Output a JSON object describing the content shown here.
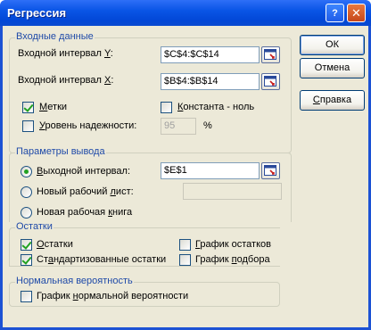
{
  "window": {
    "title": "Регрессия",
    "help_glyph": "?",
    "close_glyph": "✕"
  },
  "input_group": {
    "title": "Входные данные",
    "y_label_pre": "Входной интервал ",
    "y_label_acc": "Y",
    "y_label_post": ":",
    "y_value": "$C$4:$C$14",
    "x_label_pre": "Входной интервал ",
    "x_label_acc": "X",
    "x_label_post": ":",
    "x_value": "$B$4:$B$14",
    "labels_pre": "",
    "labels_acc": "М",
    "labels_post": "етки",
    "labels_checked": true,
    "const_pre": "",
    "const_acc": "К",
    "const_post": "онстанта - ноль",
    "const_checked": false,
    "conf_pre": "",
    "conf_acc": "У",
    "conf_post": "ровень надежности:",
    "conf_checked": false,
    "conf_value": "95",
    "conf_unit": "%"
  },
  "output_group": {
    "title": "Параметры вывода",
    "opt_range_pre": "",
    "opt_range_acc": "В",
    "opt_range_post": "ыходной интервал:",
    "opt_range_value": "$E$1",
    "opt_sheet_pre": "Новый рабочий ",
    "opt_sheet_acc": "л",
    "opt_sheet_post": "ист:",
    "opt_sheet_value": "",
    "opt_book_pre": "Новая рабочая ",
    "opt_book_acc": "к",
    "opt_book_post": "нига",
    "selected": "range"
  },
  "residuals_group": {
    "title": "Остатки",
    "resid_pre": "",
    "resid_acc": "О",
    "resid_post": "статки",
    "resid_checked": true,
    "std_pre": "Ст",
    "std_acc": "а",
    "std_post": "ндартизованные остатки",
    "std_checked": true,
    "resid_plot_pre": "",
    "resid_plot_acc": "Г",
    "resid_plot_post": "рафик остатков",
    "resid_plot_checked": false,
    "fit_plot_pre": "График ",
    "fit_plot_acc": "п",
    "fit_plot_post": "одбора",
    "fit_plot_checked": false
  },
  "normal_group": {
    "title": "Нормальная вероятность",
    "norm_pre": "График ",
    "norm_acc": "н",
    "norm_post": "ормальной вероятности",
    "norm_checked": false
  },
  "buttons": {
    "ok": "ОК",
    "cancel": "Отмена",
    "help_pre": "",
    "help_acc": "С",
    "help_post": "правка"
  },
  "icons": {
    "ref_button": "collapse-dialog-icon"
  },
  "colors": {
    "titlebar": "#0a55e6",
    "dialog_bg": "#ece9d8",
    "group_title": "#1f4aa8",
    "check_mark": "#21a121"
  }
}
